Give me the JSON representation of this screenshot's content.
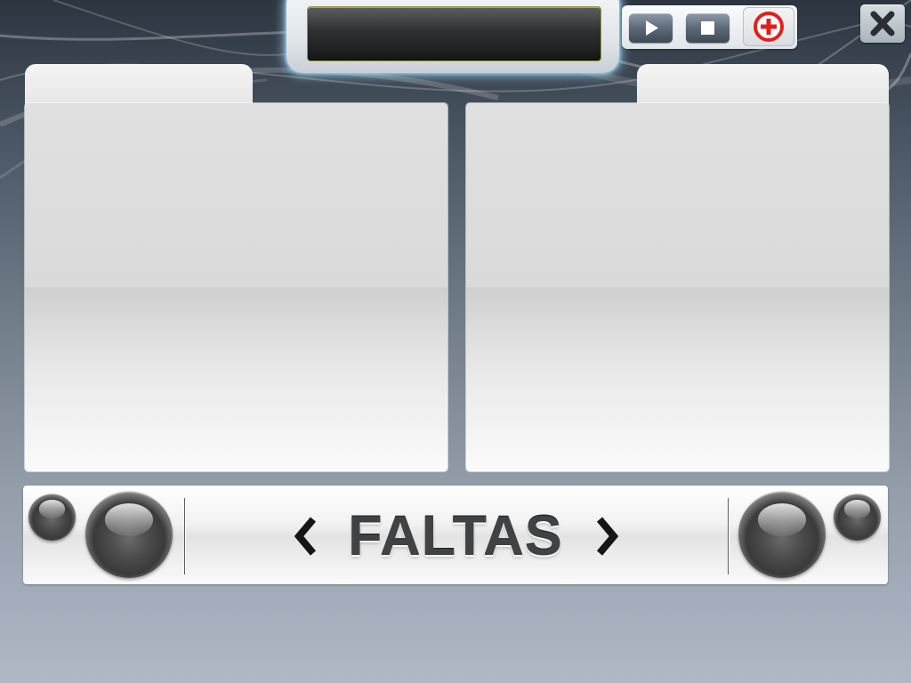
{
  "display": {
    "text": ""
  },
  "controls": {
    "play_icon": "play-icon",
    "stop_icon": "stop-icon",
    "add_icon": "add-circle-icon",
    "add_color": "#e0201c"
  },
  "window": {
    "close_icon": "close-icon"
  },
  "panels": {
    "left_tab_label": "",
    "right_tab_label": ""
  },
  "bottom_bar": {
    "section_label": "FALTAS",
    "prev_icon": "chevron-left-icon",
    "next_icon": "chevron-right-icon"
  },
  "colors": {
    "background_top": "#2c3540",
    "background_bottom": "#b0b8c6",
    "display_glow": "#aae6ff",
    "label_text": "#404244"
  }
}
